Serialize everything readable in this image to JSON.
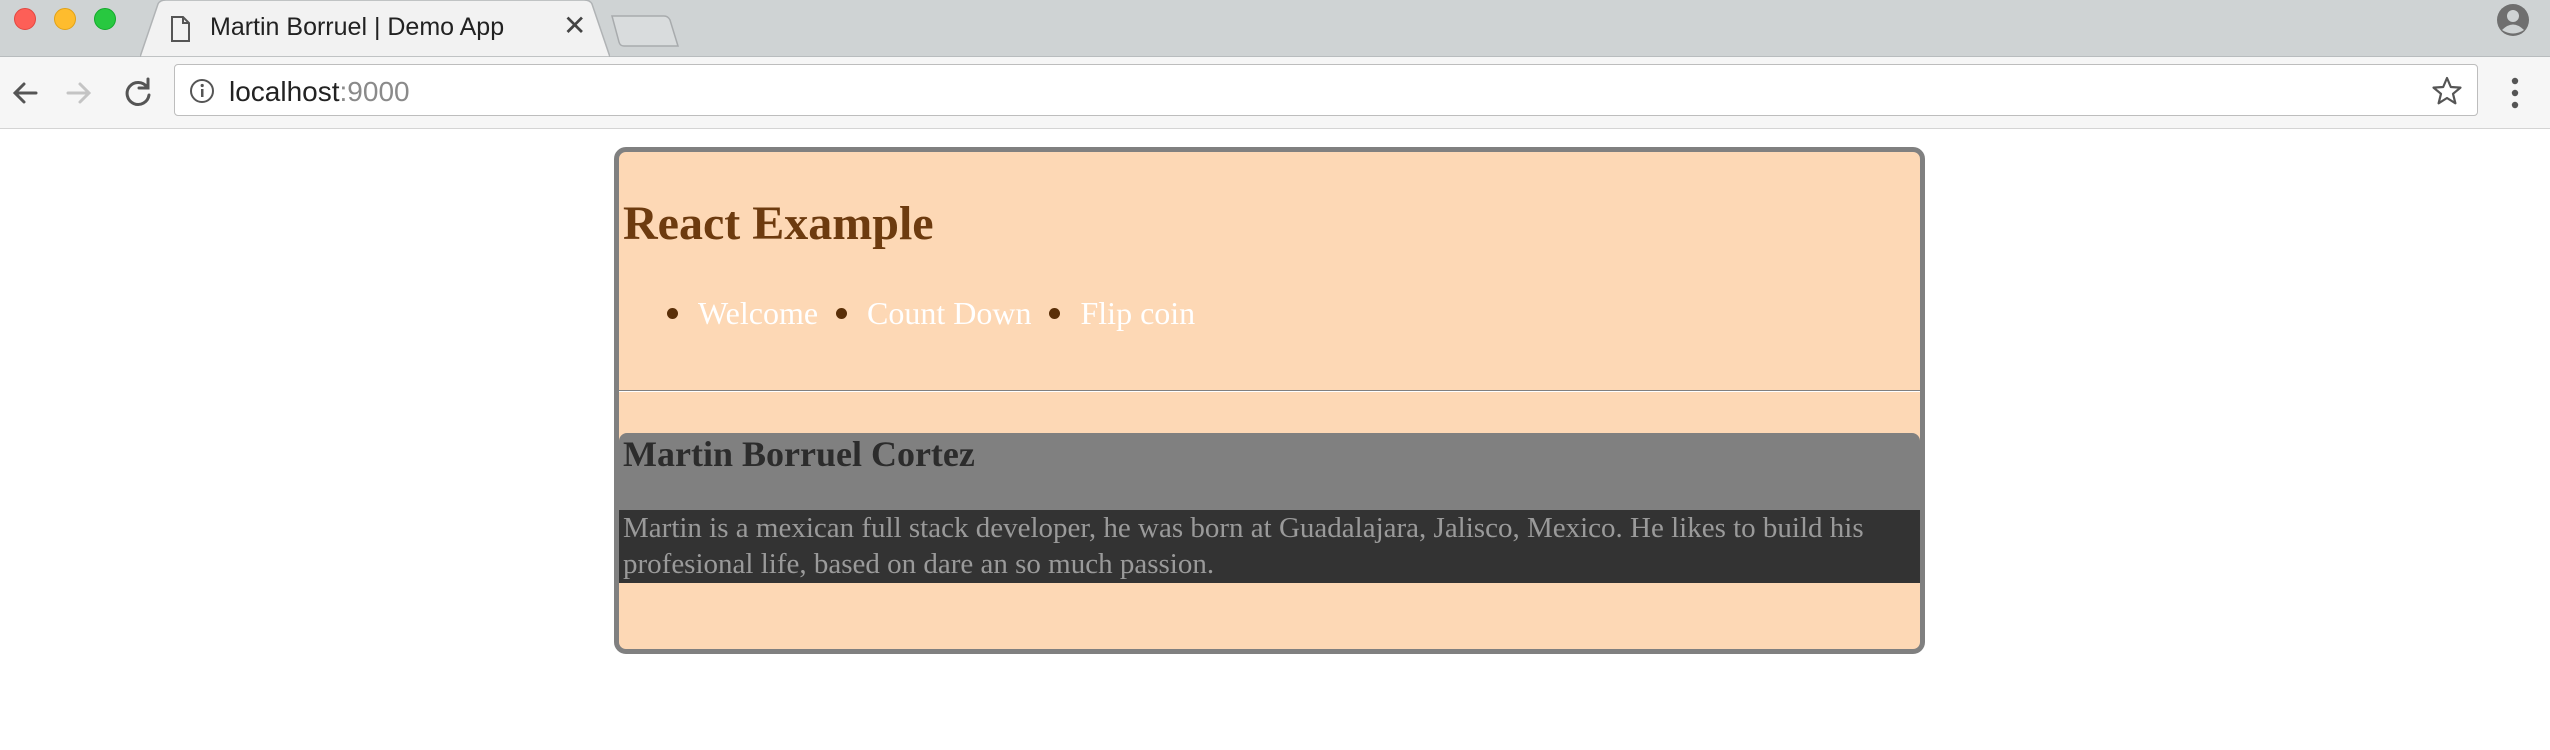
{
  "browser": {
    "tab": {
      "title": "Martin Borruel | Demo App",
      "close_glyph": "✕"
    },
    "address": {
      "host": "localhost",
      "port": ":9000"
    },
    "icons": {
      "tab_doc": "document-icon",
      "back": "back-arrow-icon",
      "forward": "forward-arrow-icon",
      "reload": "reload-icon",
      "info": "info-icon",
      "star": "star-icon",
      "menu": "kebab-menu-icon",
      "profile": "profile-icon"
    }
  },
  "page": {
    "title": "React Example",
    "nav": [
      "Welcome",
      "Count Down",
      "Flip coin"
    ],
    "profile": {
      "name": "Martin Borruel Cortez",
      "bio": "Martin is a mexican full stack developer, he was born at Guadalajara, Jalisco, Mexico. He likes to build his profesional life, based on dare an so much passion."
    }
  },
  "colors": {
    "card_background": "#fdd8b5",
    "card_border": "#808080",
    "title": "#6d3b0f",
    "nav_link": "#ffffff",
    "profile_header": "#808080",
    "bio_background": "#333333",
    "bio_text": "#9a9a9a"
  }
}
